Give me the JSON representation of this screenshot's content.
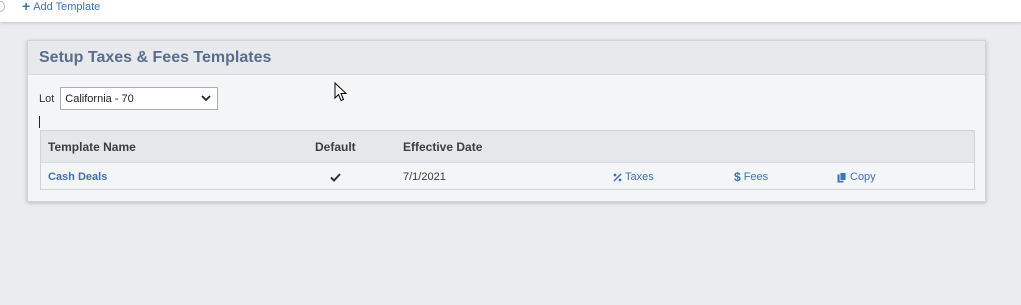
{
  "topbar": {
    "add_template_label": "Add Template"
  },
  "panel": {
    "title": "Setup Taxes & Fees Templates",
    "lot_label": "Lot",
    "lot_value": "California - 70"
  },
  "table": {
    "headers": {
      "name": "Template Name",
      "default": "Default",
      "effective": "Effective Date"
    },
    "rows": [
      {
        "name": "Cash Deals",
        "default": true,
        "effective_date": "7/1/2021",
        "actions": {
          "taxes": "Taxes",
          "fees": "Fees",
          "copy": "Copy"
        }
      }
    ]
  },
  "colors": {
    "link": "#3b73b9",
    "title": "#5a6d8c"
  },
  "icons": {
    "add": "plus-icon",
    "default": "checkmark-icon",
    "taxes": "percent-icon",
    "fees": "dollar-icon",
    "copy": "copy-icon",
    "select": "chevron-down-icon",
    "pointer": "mouse-pointer-icon"
  }
}
